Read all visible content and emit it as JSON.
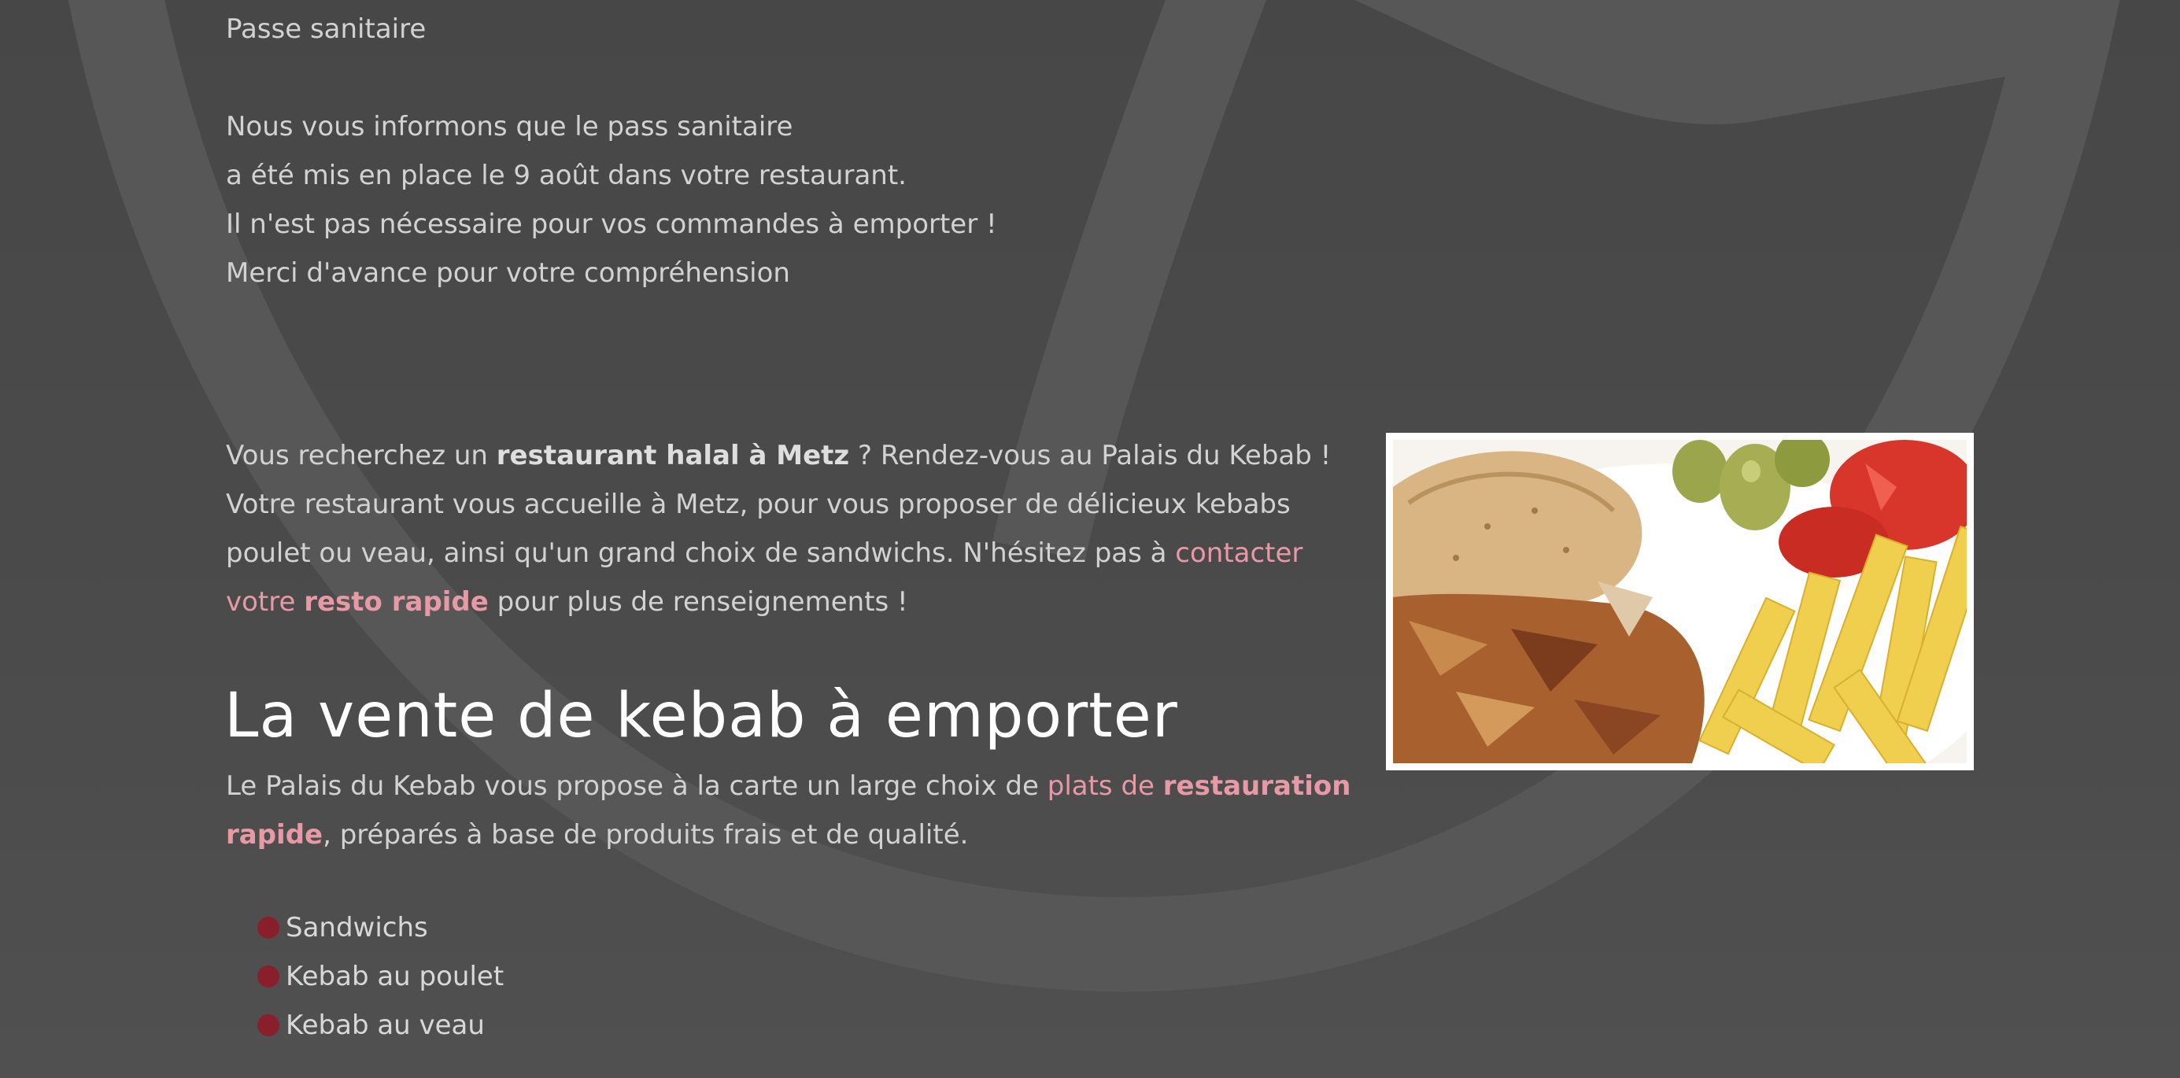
{
  "notice": {
    "title": "Passe sanitaire",
    "lines": [
      "Nous vous informons que le pass sanitaire",
      "a été mis en place le 9 août dans votre restaurant.",
      "Il n'est pas nécessaire pour vos commandes à emporter !",
      "Merci d'avance pour votre compréhension"
    ]
  },
  "intro": {
    "part1": "Vous recherchez un ",
    "bold1": "restaurant halal à Metz",
    "part2": " ? Rendez-vous au Palais du Kebab ! Votre restaurant vous accueille à Metz, pour vous proposer de délicieux kebabs poulet ou veau, ainsi qu'un grand choix de sandwichs. N'hésitez pas à ",
    "link_text": "contacter votre ",
    "link_bold": "resto rapide",
    "part3": " pour plus de renseignements !"
  },
  "section": {
    "title": "La vente de kebab à emporter",
    "desc_part1": "Le Palais du Kebab vous propose à la carte un large choix de ",
    "desc_link": "plats de ",
    "desc_link_bold": "restauration rapide",
    "desc_part2": ", préparés à base de produits frais et de qualité."
  },
  "menu_items": [
    "Sandwichs",
    "Kebab au poulet",
    "Kebab au veau"
  ],
  "image": {
    "subject": "kebab-plate-photo"
  },
  "colors": {
    "background": "#4a4a4a",
    "text": "#d2d2d2",
    "link": "#e79aa6",
    "bullet": "#8a1f2c",
    "heading": "#ffffff"
  }
}
